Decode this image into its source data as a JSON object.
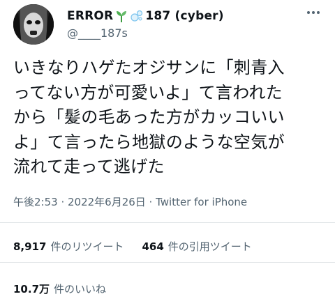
{
  "tweet": {
    "author": {
      "display_name_prefix": "ERROR",
      "display_name_suffix": "187 (cyber)",
      "handle": "@____187s",
      "emoji": [
        "sprout-icon",
        "bubbles-icon"
      ]
    },
    "text": "いきなりハゲたオジサンに「刺青入\nってない方が可愛いよ」て言われた\nから「髪の毛あった方がカッコいい\nよ」て言ったら地獄のような空気が\n流れて走って逃げた",
    "meta": "午後2:53 · 2022年6月26日 · Twitter for iPhone",
    "stats": {
      "retweets": {
        "count": "8,917",
        "label": "件のリツイート"
      },
      "quotes": {
        "count": "464",
        "label": "件の引用ツイート"
      },
      "likes": {
        "count": "10.7万",
        "label": "件のいいね"
      }
    }
  },
  "colors": {
    "text_primary": "#0f1419",
    "text_secondary": "#536471",
    "divider": "#dfe3e6",
    "sprout_green": "#4caf50",
    "bubble_blue": "#7cc4ee"
  }
}
